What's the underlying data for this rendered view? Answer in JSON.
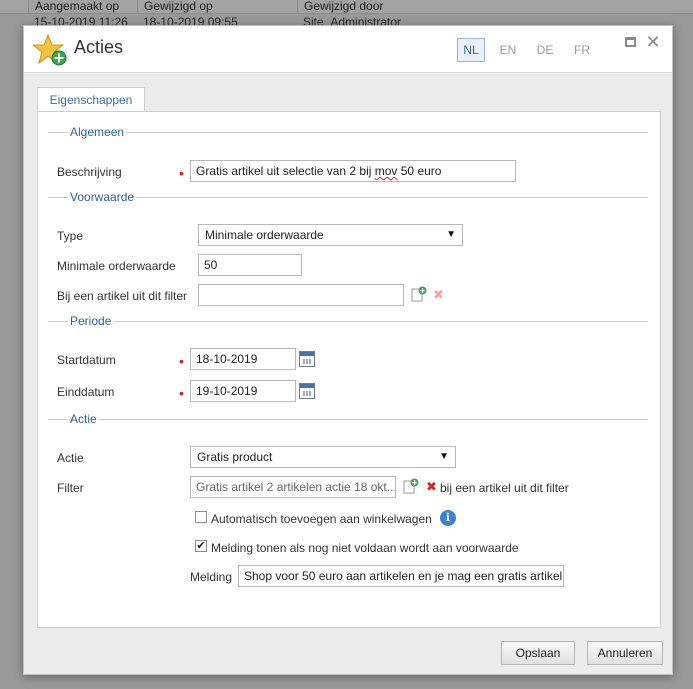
{
  "background_grid": {
    "columns": [
      "Aangemaakt op",
      "Gewijzigd op",
      "Gewijzigd door"
    ],
    "row": [
      "15-10-2019 11:26",
      "18-10-2019 09:55",
      "Site_Administrator"
    ]
  },
  "dialog": {
    "title": "Acties",
    "title_icon": "star-add-icon",
    "languages": [
      "NL",
      "EN",
      "DE",
      "FR"
    ],
    "active_language": "NL",
    "controls": {
      "maximize": "maximize-icon",
      "close": "✕"
    }
  },
  "tabs": [
    {
      "label": "Eigenschappen",
      "active": true
    }
  ],
  "sections": {
    "algemeen": {
      "title": "Algemeen",
      "beschrijving": {
        "label": "Beschrijving",
        "value_before": "Gratis artikel uit selectie van 2 bij ",
        "value_misspelled": "mov",
        "value_after": " 50 euro",
        "required": true
      }
    },
    "voorwaarde": {
      "title": "Voorwaarde",
      "type": {
        "label": "Type",
        "value": "Minimale orderwaarde"
      },
      "min_orderwaarde": {
        "label": "Minimale orderwaarde",
        "value": "50"
      },
      "filter": {
        "label": "Bij een artikel uit dit filter",
        "value": ""
      }
    },
    "periode": {
      "title": "Periode",
      "startdatum": {
        "label": "Startdatum",
        "value": "18-10-2019",
        "required": true
      },
      "einddatum": {
        "label": "Einddatum",
        "value": "19-10-2019",
        "required": true
      }
    },
    "actie": {
      "title": "Actie",
      "actie": {
        "label": "Actie",
        "value": "Gratis product"
      },
      "filter": {
        "label": "Filter",
        "value": "Gratis artikel 2 artikelen actie 18 okt...",
        "suffix": "bij een artikel uit dit filter"
      },
      "auto_add": {
        "label": "Automatisch toevoegen aan winkelwagen",
        "checked": false
      },
      "show_message": {
        "label": "Melding tonen als nog niet voldaan wordt aan voorwaarde",
        "checked": true
      },
      "melding": {
        "label": "Melding",
        "value": "Shop voor 50 euro aan artikelen en je mag een gratis artikel"
      }
    }
  },
  "buttons": {
    "save": "Opslaan",
    "cancel": "Annuleren"
  },
  "colors": {
    "accent": "#2f5f9a",
    "required": "#d61f1f",
    "remove": "#d62020",
    "add": "#2ea043"
  }
}
